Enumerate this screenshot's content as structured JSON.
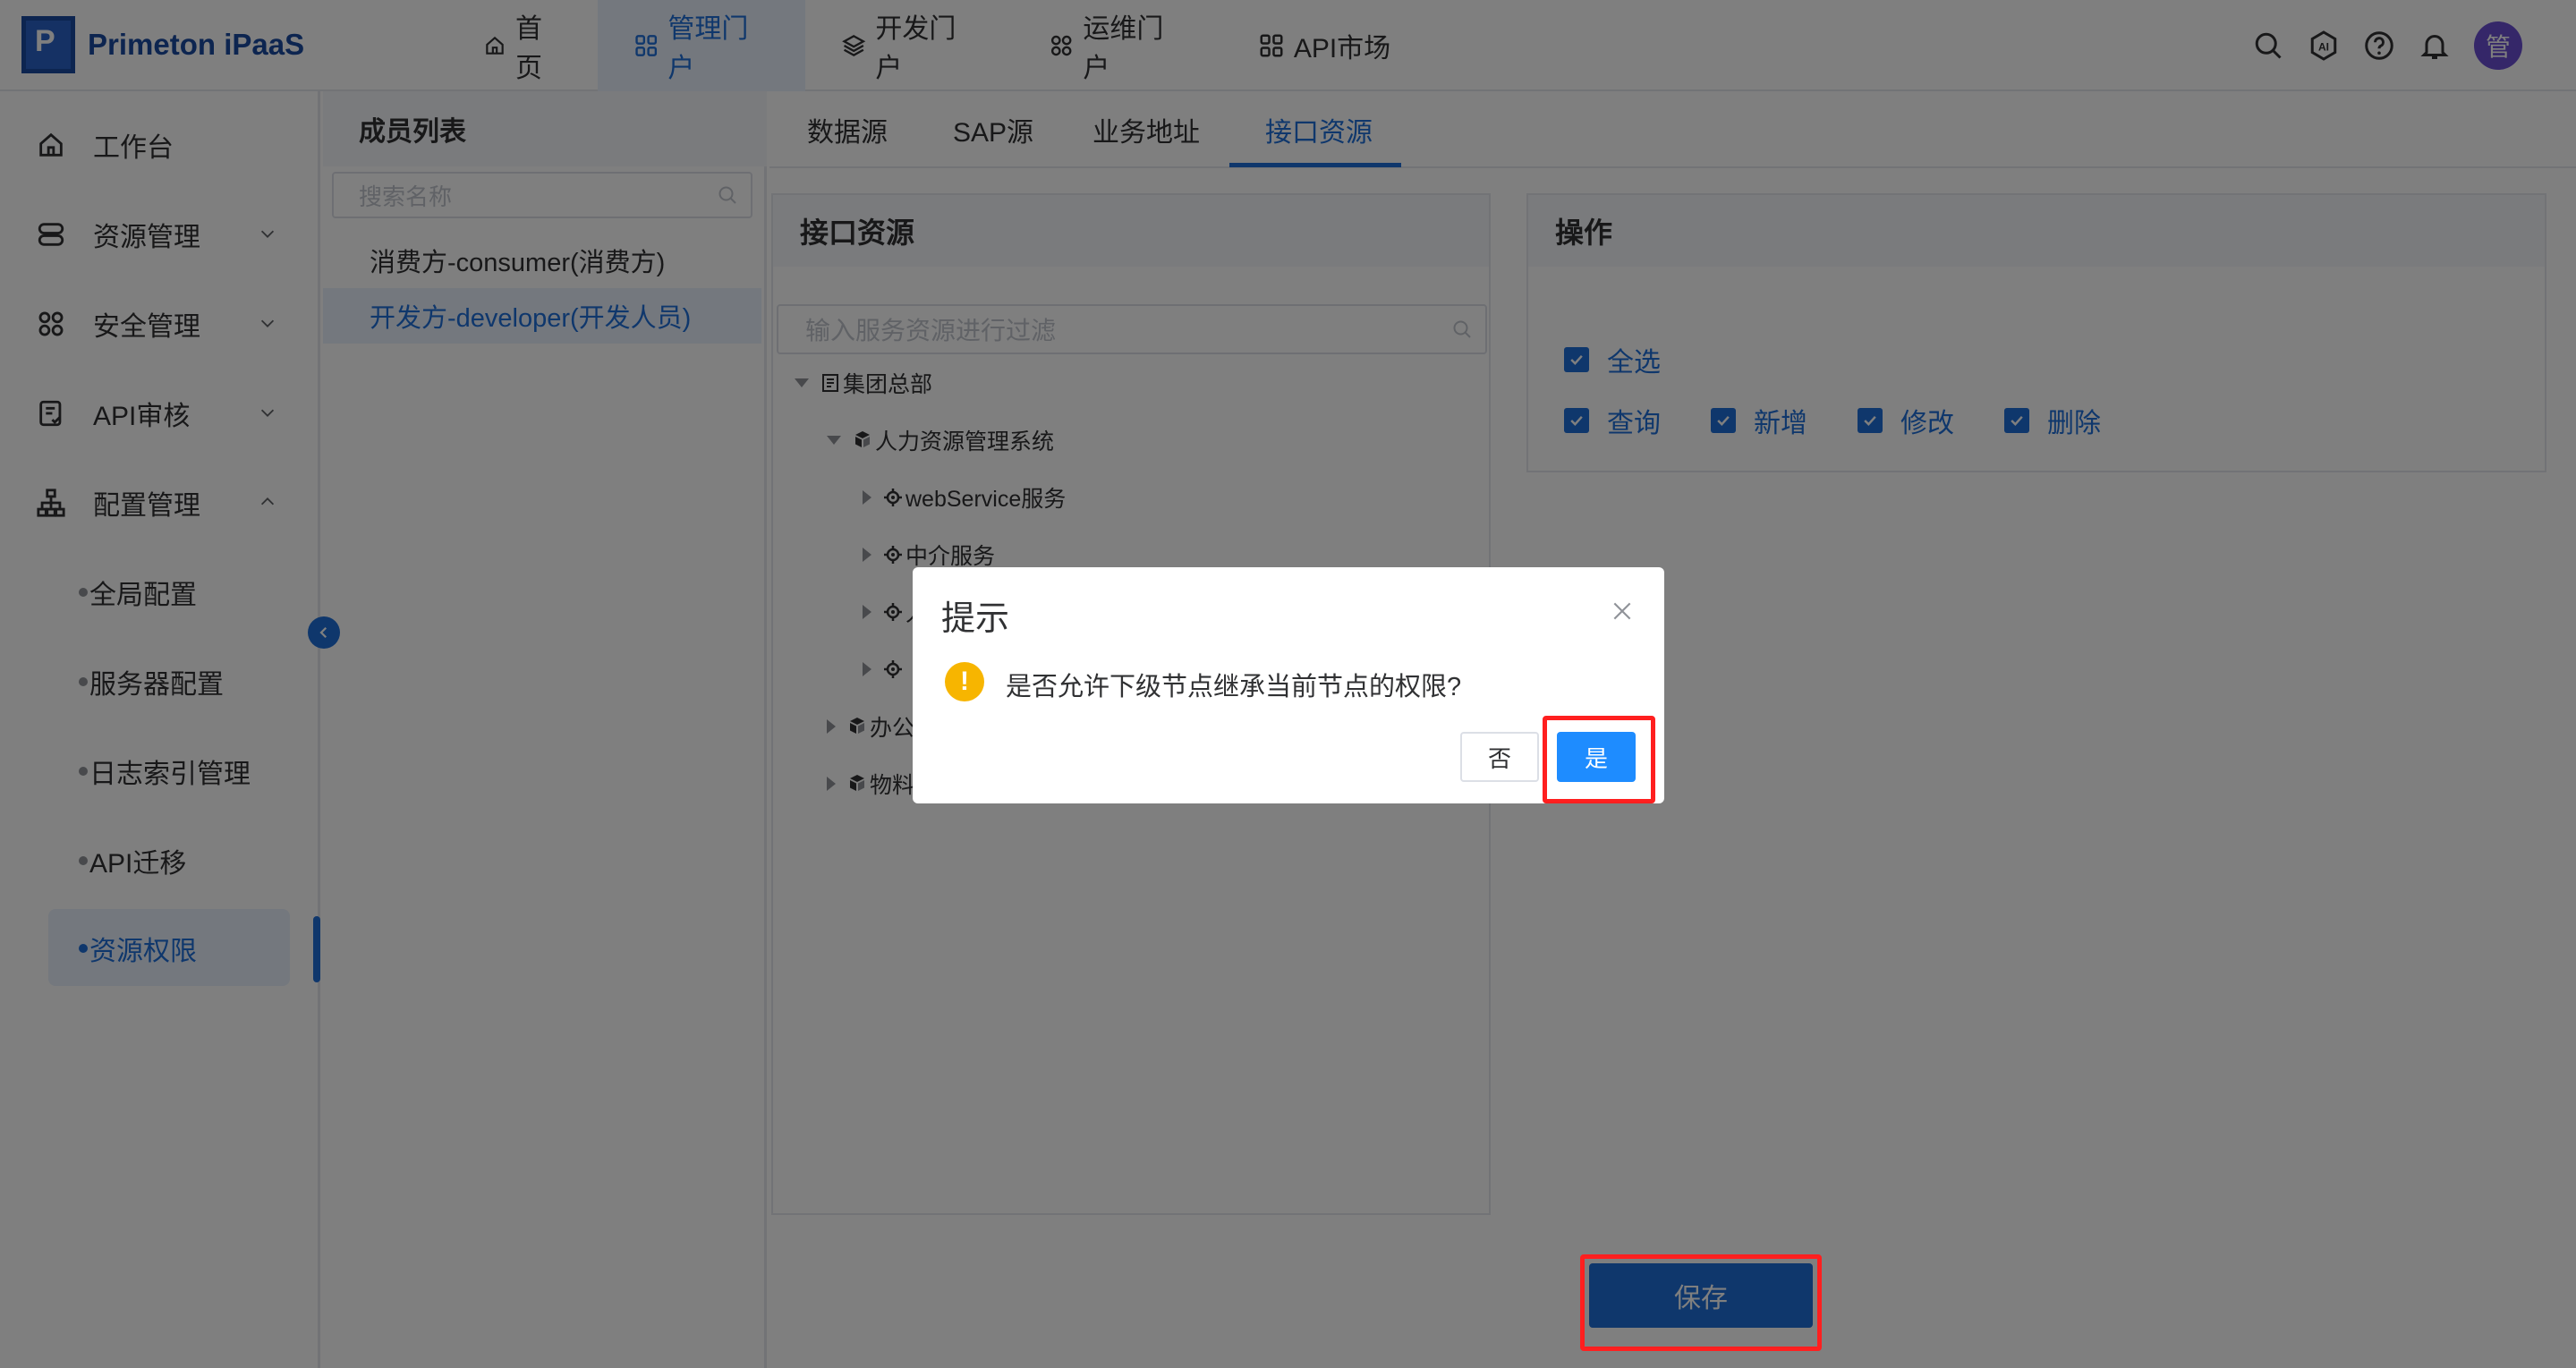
{
  "app": {
    "title": "Primeton iPaaS"
  },
  "topnav": [
    {
      "label": "首页",
      "icon": "home-icon",
      "active": false
    },
    {
      "label": "管理门户",
      "icon": "grid-icon",
      "active": true
    },
    {
      "label": "开发门户",
      "icon": "layers-icon",
      "active": false
    },
    {
      "label": "运维门户",
      "icon": "apps-icon",
      "active": false
    },
    {
      "label": "API市场",
      "icon": "grid-icon",
      "active": false
    }
  ],
  "user": {
    "avatar": "管"
  },
  "sidebar": {
    "items": [
      {
        "label": "工作台",
        "icon": "home-icon"
      },
      {
        "label": "资源管理",
        "icon": "database-icon",
        "expanded": false
      },
      {
        "label": "安全管理",
        "icon": "apps-icon",
        "expanded": false
      },
      {
        "label": "API审核",
        "icon": "audit-icon",
        "expanded": false
      },
      {
        "label": "配置管理",
        "icon": "sitemap-icon",
        "expanded": true
      }
    ],
    "sub_items": [
      {
        "label": "全局配置"
      },
      {
        "label": "服务器配置"
      },
      {
        "label": "日志索引管理"
      },
      {
        "label": "API迁移"
      },
      {
        "label": "资源权限",
        "active": true
      }
    ]
  },
  "members": {
    "title": "成员列表",
    "search_placeholder": "搜索名称",
    "items": [
      {
        "label": "消费方-consumer(消费方)",
        "active": false
      },
      {
        "label": "开发方-developer(开发人员)",
        "active": true
      }
    ]
  },
  "tabs": [
    {
      "label": "数据源",
      "active": false
    },
    {
      "label": "SAP源",
      "active": false
    },
    {
      "label": "业务地址",
      "active": false
    },
    {
      "label": "接口资源",
      "active": true
    }
  ],
  "resource_panel": {
    "title": "接口资源",
    "filter_placeholder": "输入服务资源进行过滤",
    "tree": [
      {
        "label": "集团总部",
        "expanded": true
      },
      {
        "label": "人力资源管理系统",
        "expanded": true
      },
      {
        "label": "webService服务"
      },
      {
        "label": "中介服务"
      },
      {
        "label": "人"
      },
      {
        "label": ""
      },
      {
        "label": "办公"
      },
      {
        "label": "物料"
      }
    ]
  },
  "operations": {
    "title": "操作",
    "select_all": "全选",
    "checks": [
      "查询",
      "新增",
      "修改",
      "删除"
    ]
  },
  "save_label": "保存",
  "dialog": {
    "title": "提示",
    "message": "是否允许下级节点继承当前节点的权限?",
    "no_label": "否",
    "yes_label": "是"
  },
  "colors": {
    "accent": "#1e6fd9",
    "highlight": "#ff1f1f",
    "warning": "#f7b500"
  }
}
